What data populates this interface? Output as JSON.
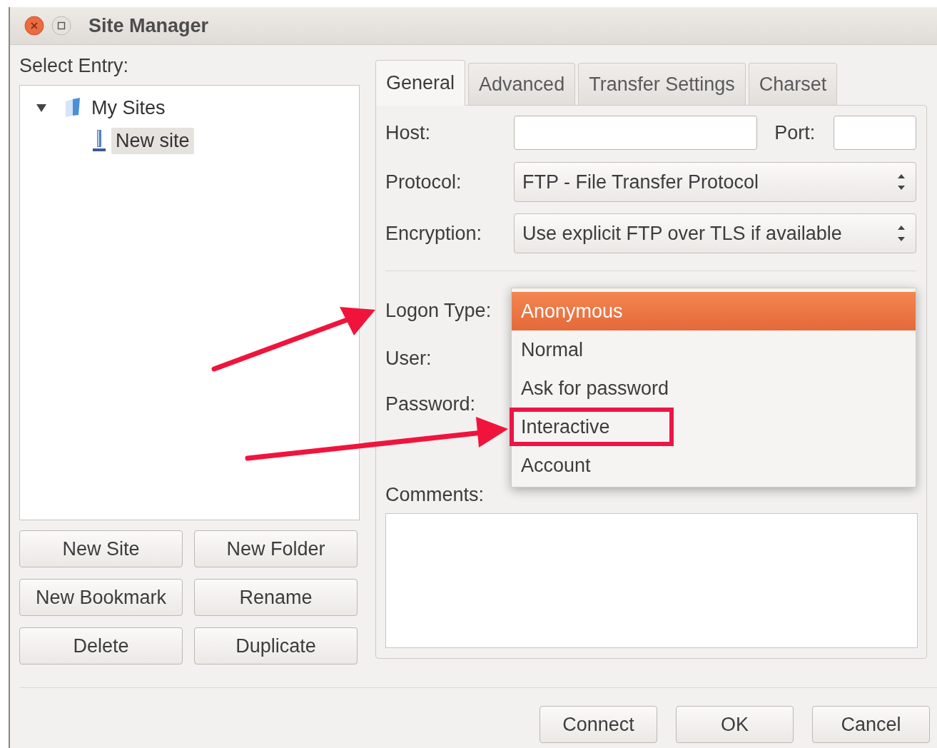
{
  "window": {
    "title": "Site Manager"
  },
  "select_entry_label": "Select Entry:",
  "tree": [
    {
      "label": "My Sites",
      "kind": "folder",
      "expanded": true,
      "selected": false,
      "children": [
        {
          "label": "New site",
          "kind": "site",
          "selected": true
        }
      ]
    }
  ],
  "left_buttons": [
    "New Site",
    "New Folder",
    "New Bookmark",
    "Rename",
    "Delete",
    "Duplicate"
  ],
  "tabs": [
    {
      "label": "General",
      "selected": true
    },
    {
      "label": "Advanced",
      "selected": false
    },
    {
      "label": "Transfer Settings",
      "selected": false
    },
    {
      "label": "Charset",
      "selected": false
    }
  ],
  "host": {
    "label": "Host:"
  },
  "port": {
    "label": "Port:"
  },
  "protocol": {
    "label": "Protocol:",
    "value": "FTP - File Transfer Protocol"
  },
  "encryption": {
    "label": "Encryption:",
    "value": "Use explicit FTP over TLS if available"
  },
  "logon_type": {
    "label": "Logon Type:",
    "options": [
      {
        "label": "Anonymous",
        "selected": true,
        "highlighted": false
      },
      {
        "label": "Normal",
        "selected": false,
        "highlighted": false
      },
      {
        "label": "Ask for password",
        "selected": false,
        "highlighted": false
      },
      {
        "label": "Interactive",
        "selected": false,
        "highlighted": true
      },
      {
        "label": "Account",
        "selected": false,
        "highlighted": false
      }
    ]
  },
  "user_label": "User:",
  "password_label": "Password:",
  "comments": {
    "label": "Comments:"
  },
  "bottom_buttons": [
    "Connect",
    "OK",
    "Cancel"
  ]
}
